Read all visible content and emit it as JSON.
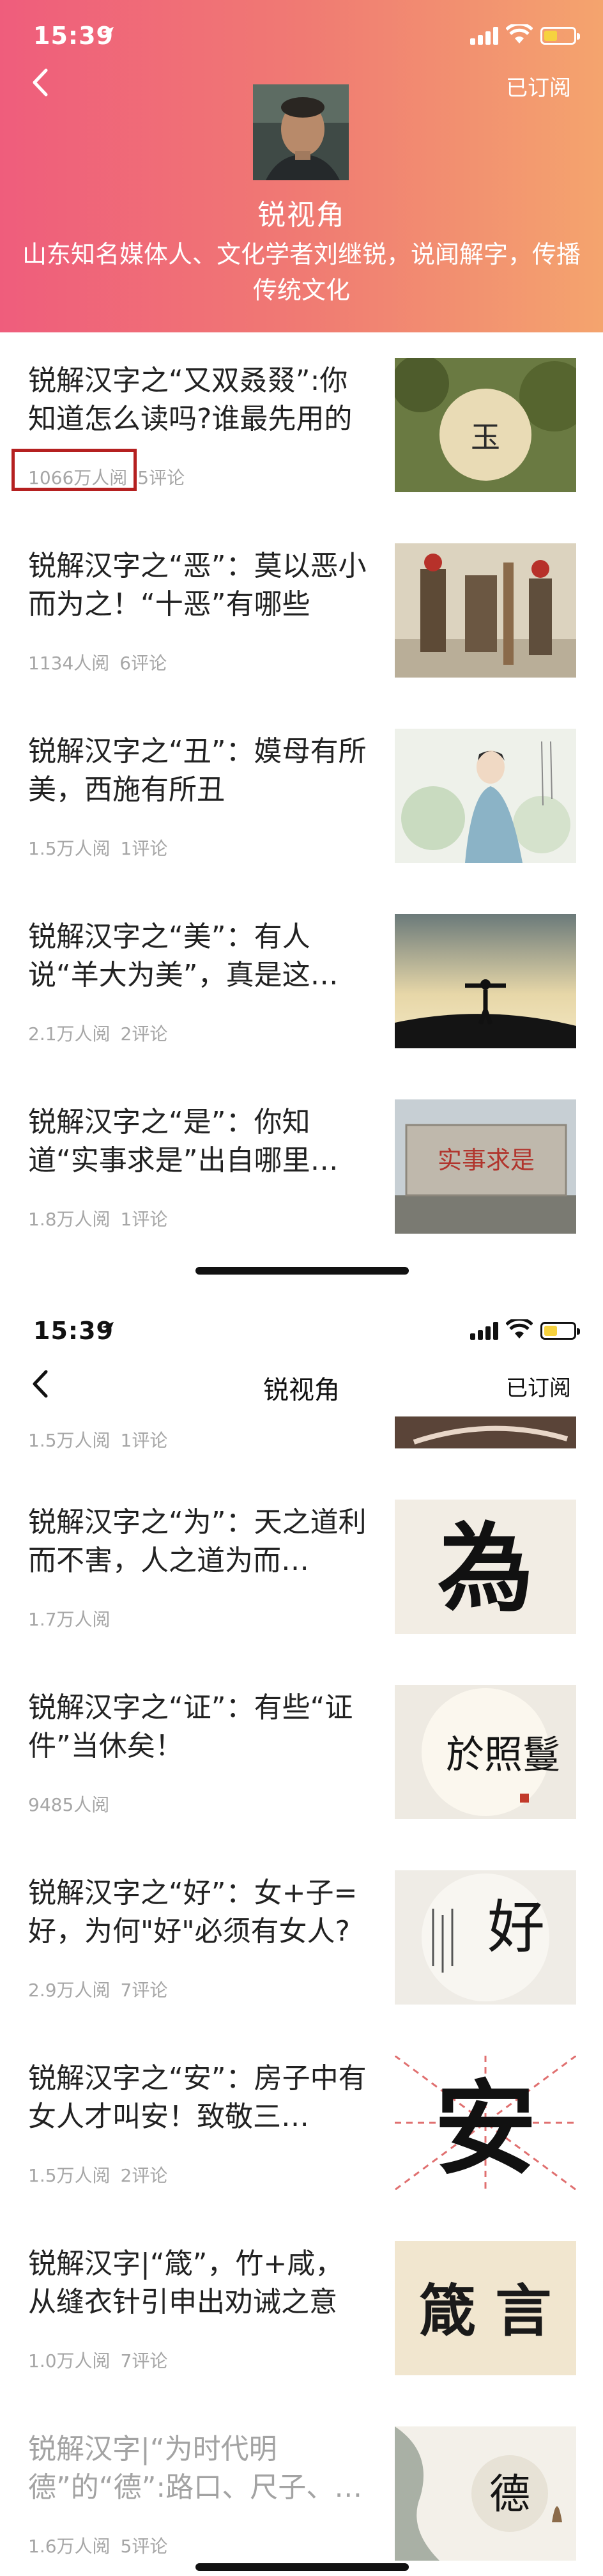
{
  "status": {
    "time": "15:39"
  },
  "channel": {
    "name": "锐视角",
    "description": "山东知名媒体人、文化学者刘继锐，说闻解字，传播传统文化",
    "subscribe_label": "已订阅"
  },
  "articles_top": [
    {
      "title": "锐解汉字之“又双叒叕”:你知道怎么读吗?谁最先用的",
      "views": "1066万人阅",
      "comments": "5评论"
    },
    {
      "title": "锐解汉字之“恶”：莫以恶小而为之！“十恶”有哪些",
      "views": "1134人阅",
      "comments": "6评论"
    },
    {
      "title": "锐解汉字之“丑”：嫫母有所美，西施有所丑",
      "views": "1.5万人阅",
      "comments": "1评论"
    },
    {
      "title": "锐解汉字之“美”：有人说“羊大为美”，真是这…",
      "views": "2.1万人阅",
      "comments": "2评论"
    },
    {
      "title": "锐解汉字之“是”：你知道“实事求是”出自哪里…",
      "views": "1.8万人阅",
      "comments": "1评论"
    }
  ],
  "partial_item": {
    "views": "1.5万人阅",
    "comments": "1评论"
  },
  "articles_bottom": [
    {
      "title": "锐解汉字之“为”：天之道利而不害，人之道为而…",
      "views": "1.7万人阅",
      "comments": ""
    },
    {
      "title": "锐解汉字之“证”：有些“证件”当休矣！",
      "views": "9485人阅",
      "comments": ""
    },
    {
      "title": "锐解汉字之“好”：女+子=好，为何\"好\"必须有女人?",
      "views": "2.9万人阅",
      "comments": "7评论"
    },
    {
      "title": "锐解汉字之“安”：房子中有女人才叫安！致敬三…",
      "views": "1.5万人阅",
      "comments": "2评论"
    },
    {
      "title": "锐解汉字|“箴”，竹+咸，从缝衣针引申出劝诫之意",
      "views": "1.0万人阅",
      "comments": "7评论"
    },
    {
      "title": "锐解汉字|“为时代明德”的“德”:路口、尺子、…",
      "views": "1.6万人阅",
      "comments": "5评论"
    }
  ],
  "thumb_text": {
    "img1": "玉",
    "img6": "实事求是",
    "img7": "為",
    "img8": "於照鬘",
    "img9": "好",
    "img10": "安",
    "img11": "箴 言",
    "img12": "德"
  },
  "colors": {
    "header_gradient_start": "#ef5d7c",
    "header_gradient_end": "#f4a46e",
    "highlight_border": "#b52020",
    "meta_text": "#a6a6a6"
  }
}
